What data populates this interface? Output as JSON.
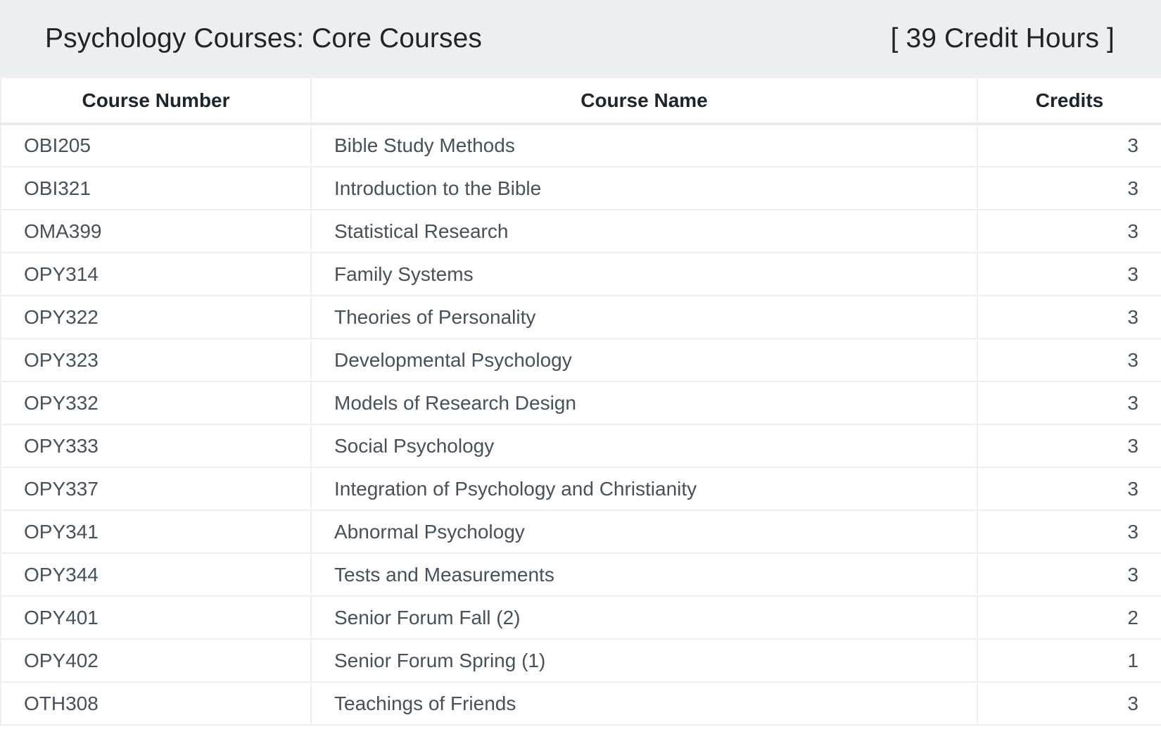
{
  "header": {
    "title": "Psychology Courses: Core Courses",
    "credit_hours": "[ 39 Credit Hours ]"
  },
  "table": {
    "columns": [
      "Course Number",
      "Course Name",
      "Credits"
    ],
    "rows": [
      {
        "number": "OBI205",
        "name": "Bible Study Methods",
        "credits": "3"
      },
      {
        "number": "OBI321",
        "name": "Introduction to the Bible",
        "credits": "3"
      },
      {
        "number": "OMA399",
        "name": "Statistical Research",
        "credits": "3"
      },
      {
        "number": "OPY314",
        "name": "Family Systems",
        "credits": "3"
      },
      {
        "number": "OPY322",
        "name": "Theories of Personality",
        "credits": "3"
      },
      {
        "number": "OPY323",
        "name": "Developmental Psychology",
        "credits": "3"
      },
      {
        "number": "OPY332",
        "name": "Models of Research Design",
        "credits": "3"
      },
      {
        "number": "OPY333",
        "name": "Social Psychology",
        "credits": "3"
      },
      {
        "number": "OPY337",
        "name": "Integration of Psychology and Christianity",
        "credits": "3"
      },
      {
        "number": "OPY341",
        "name": "Abnormal Psychology",
        "credits": "3"
      },
      {
        "number": "OPY344",
        "name": "Tests and Measurements",
        "credits": "3"
      },
      {
        "number": "OPY401",
        "name": "Senior Forum Fall (2)",
        "credits": "2"
      },
      {
        "number": "OPY402",
        "name": "Senior Forum Spring (1)",
        "credits": "1"
      },
      {
        "number": "OTH308",
        "name": "Teachings of Friends",
        "credits": "3"
      }
    ]
  }
}
